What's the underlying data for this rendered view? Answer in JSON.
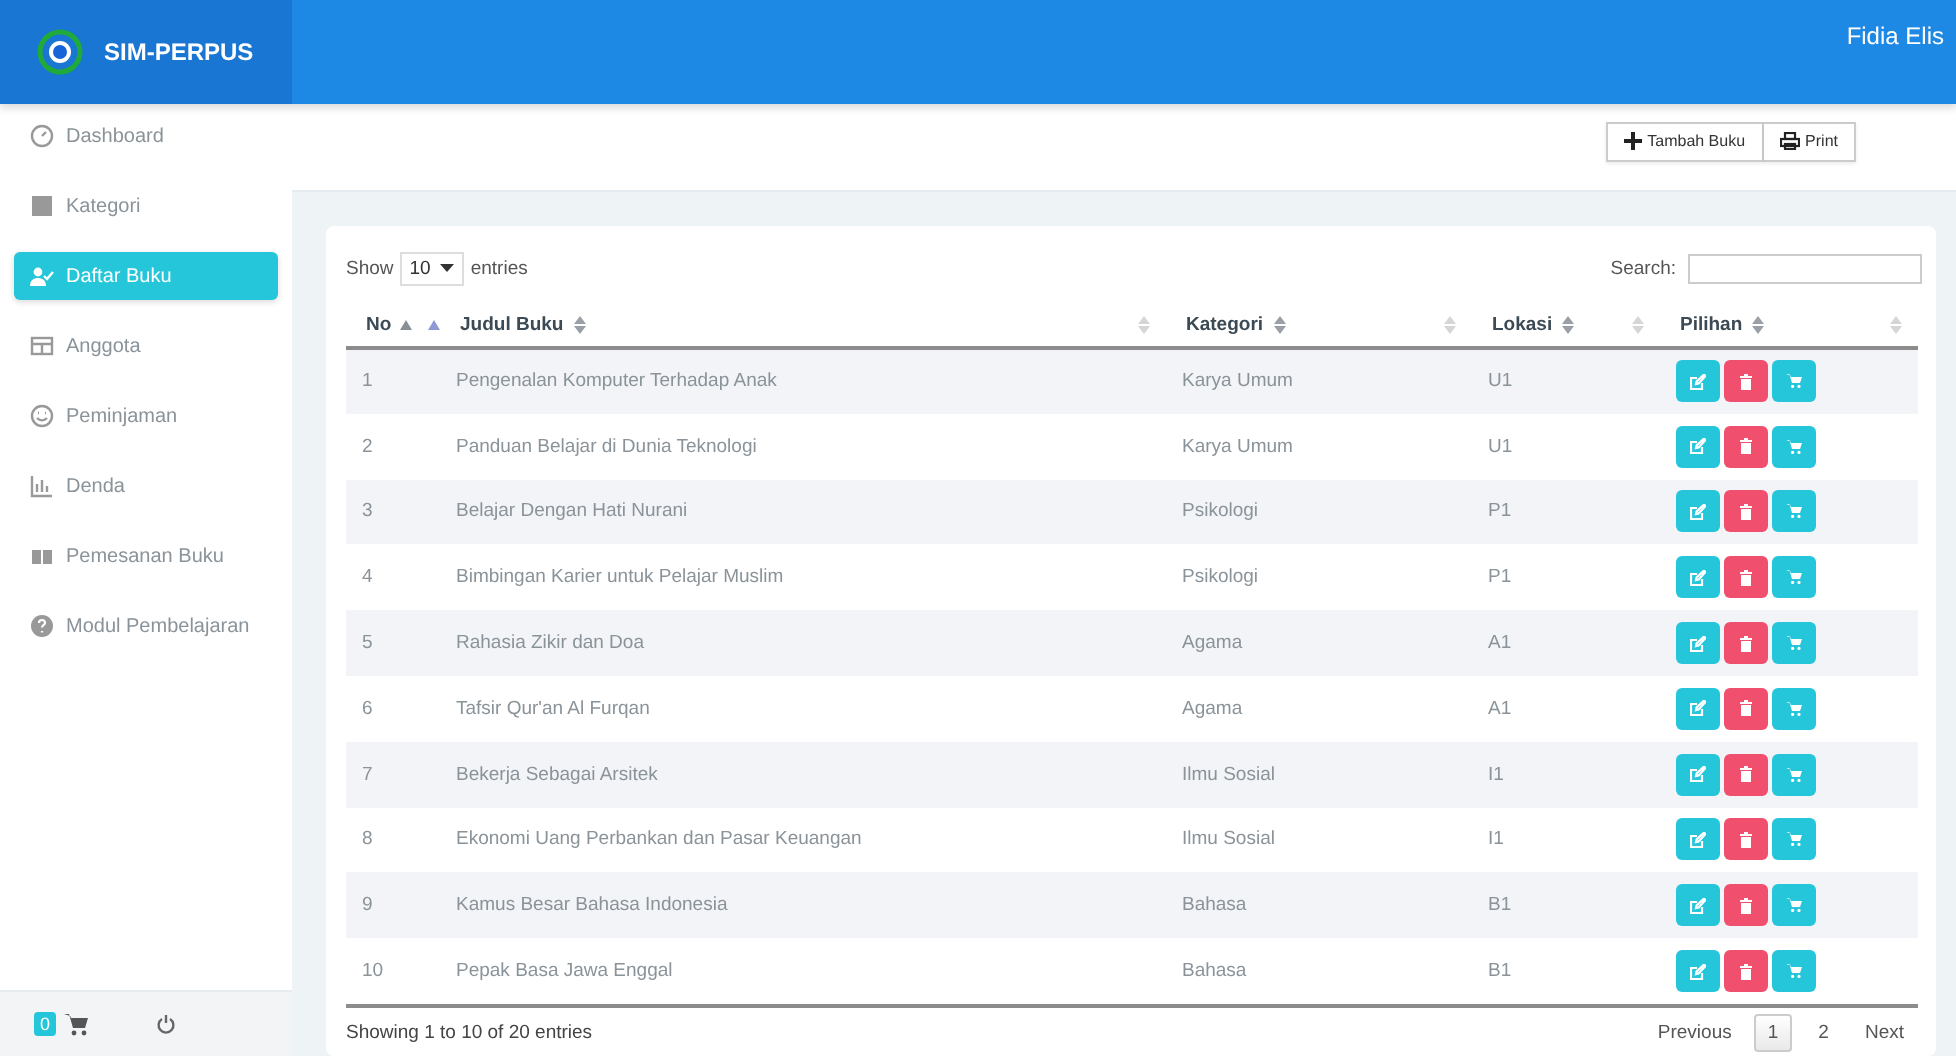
{
  "app": {
    "title": "SIM-PERPUS"
  },
  "user": {
    "name": "Fidia Elis"
  },
  "sidebar": {
    "items": [
      {
        "label": "Dashboard",
        "selected": false
      },
      {
        "label": "Kategori",
        "selected": false
      },
      {
        "label": "Daftar Buku",
        "selected": true
      },
      {
        "label": "Anggota",
        "selected": false
      },
      {
        "label": "Peminjaman",
        "selected": false
      },
      {
        "label": "Denda",
        "selected": false
      },
      {
        "label": "Pemesanan Buku",
        "selected": false
      },
      {
        "label": "Modul Pembelajaran",
        "selected": false
      }
    ]
  },
  "sidebar_footer": {
    "cart_count": "0"
  },
  "toolbar": {
    "buttons": [
      {
        "label": "Tambah Buku"
      },
      {
        "label": "Print"
      }
    ]
  },
  "table_controls": {
    "show_label": "Show",
    "page_size": "10",
    "entries_label": "entries",
    "search_label": "Search:"
  },
  "table": {
    "columns": [
      {
        "label": "No",
        "sorted": true
      },
      {
        "label": "Judul Buku",
        "sorted": false
      },
      {
        "label": "Kategori",
        "sorted": false
      },
      {
        "label": "Lokasi",
        "sorted": false
      },
      {
        "label": "Pilihan",
        "sorted": false
      }
    ],
    "rows": [
      {
        "no": "1",
        "judul": "Pengenalan Komputer Terhadap Anak",
        "kategori": "Karya Umum",
        "lokasi": "U1"
      },
      {
        "no": "2",
        "judul": "Panduan Belajar di Dunia Teknologi",
        "kategori": "Karya Umum",
        "lokasi": "U1"
      },
      {
        "no": "3",
        "judul": "Belajar Dengan Hati Nurani",
        "kategori": "Psikologi",
        "lokasi": "P1"
      },
      {
        "no": "4",
        "judul": "Bimbingan Karier untuk Pelajar Muslim",
        "kategori": "Psikologi",
        "lokasi": "P1"
      },
      {
        "no": "5",
        "judul": "Rahasia Zikir dan Doa",
        "kategori": "Agama",
        "lokasi": "A1"
      },
      {
        "no": "6",
        "judul": "Tafsir Qur'an Al Furqan",
        "kategori": "Agama",
        "lokasi": "A1"
      },
      {
        "no": "7",
        "judul": "Bekerja Sebagai Arsitek",
        "kategori": "Ilmu Sosial",
        "lokasi": "I1"
      },
      {
        "no": "8",
        "judul": "Ekonomi Uang Perbankan dan Pasar Keuangan",
        "kategori": "Ilmu Sosial",
        "lokasi": "I1"
      },
      {
        "no": "9",
        "judul": "Kamus Besar Bahasa Indonesia",
        "kategori": "Bahasa",
        "lokasi": "B1"
      },
      {
        "no": "10",
        "judul": "Pepak Basa Jawa Enggal",
        "kategori": "Bahasa",
        "lokasi": "B1"
      }
    ]
  },
  "footer": {
    "info": "Showing 1 to 10 of 20 entries",
    "pagination": [
      {
        "label": "Previous",
        "kind": "prev",
        "selected": false
      },
      {
        "label": "1",
        "kind": "page",
        "selected": true
      },
      {
        "label": "2",
        "kind": "page",
        "selected": false
      },
      {
        "label": "Next",
        "kind": "next",
        "selected": false
      }
    ]
  }
}
